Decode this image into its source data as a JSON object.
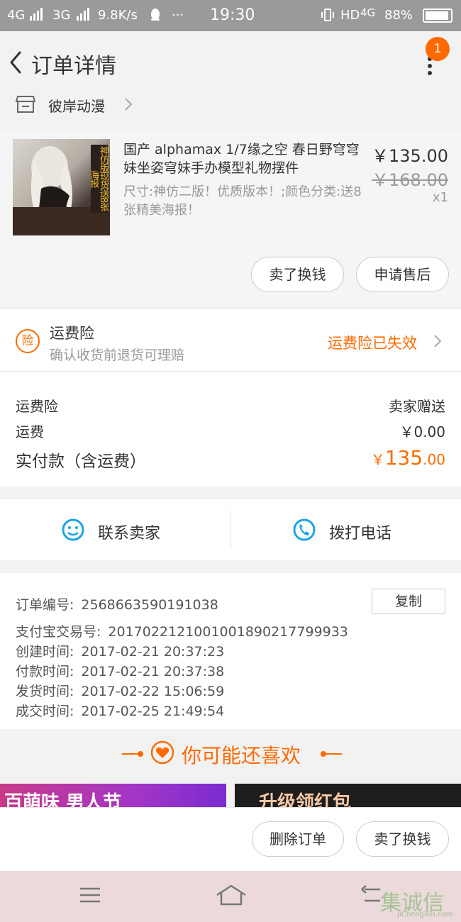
{
  "status_bar": {
    "net1": "4G",
    "net2": "3G",
    "speed": "9.8K/s",
    "dots": "···",
    "time": "19:30",
    "hd": "HD",
    "net3": "4G",
    "battery": "88%"
  },
  "nav": {
    "title": "订单详情",
    "badge": "1"
  },
  "shop": {
    "name": "彼岸动漫"
  },
  "item": {
    "title": "国产 alphamax 1/7缘之空 春日野穹穹妹坐姿穹妹手办模型礼物摆件",
    "sku": "尺寸:神仿二版！优质版本！;颜色分类:送8张精美海报！",
    "price": "￥135.00",
    "original_price": "￥168.00",
    "quantity": "x1",
    "thumb_tag": "神仿版现货送8张海报",
    "sell_button": "卖了换钱",
    "after_sale_button": "申请售后"
  },
  "insurance": {
    "icon_label": "险",
    "title": "运费险",
    "subtitle": "确认收货前退货可理赔",
    "status": "运费险已失效"
  },
  "costs": {
    "insurance_label": "运费险",
    "insurance_value": "卖家赠送",
    "shipping_label": "运费",
    "shipping_value": "￥0.00",
    "total_label": "实付款（含运费）",
    "total_currency": "￥",
    "total_int": "135",
    "total_dec": ".00"
  },
  "contact": {
    "seller_label": "联系卖家",
    "phone_label": "拨打电话"
  },
  "order_info": {
    "copy_button": "复制",
    "rows": [
      {
        "label": "订单编号:",
        "value": "2568663590191038"
      },
      {
        "label": "支付宝交易号:",
        "value": "2017022121001001890217799933"
      },
      {
        "label": "创建时间:",
        "value": "2017-02-21 20:37:23"
      },
      {
        "label": "付款时间:",
        "value": "2017-02-21 20:37:38"
      },
      {
        "label": "发货时间:",
        "value": "2017-02-22 15:06:59"
      },
      {
        "label": "成交时间:",
        "value": "2017-02-25 21:49:54"
      }
    ]
  },
  "recommend": {
    "title": "你可能还喜欢",
    "promo1_text": "百萌味 男人节",
    "promo2_text": "升级领红包"
  },
  "actions": {
    "delete_button": "删除订单",
    "sell_button": "卖了换钱"
  },
  "watermark": {
    "text": "集诚信",
    "sub": "JiChengXin.com"
  },
  "colors": {
    "accent": "#ff6a00",
    "contact_icon": "#1aa3e8"
  }
}
